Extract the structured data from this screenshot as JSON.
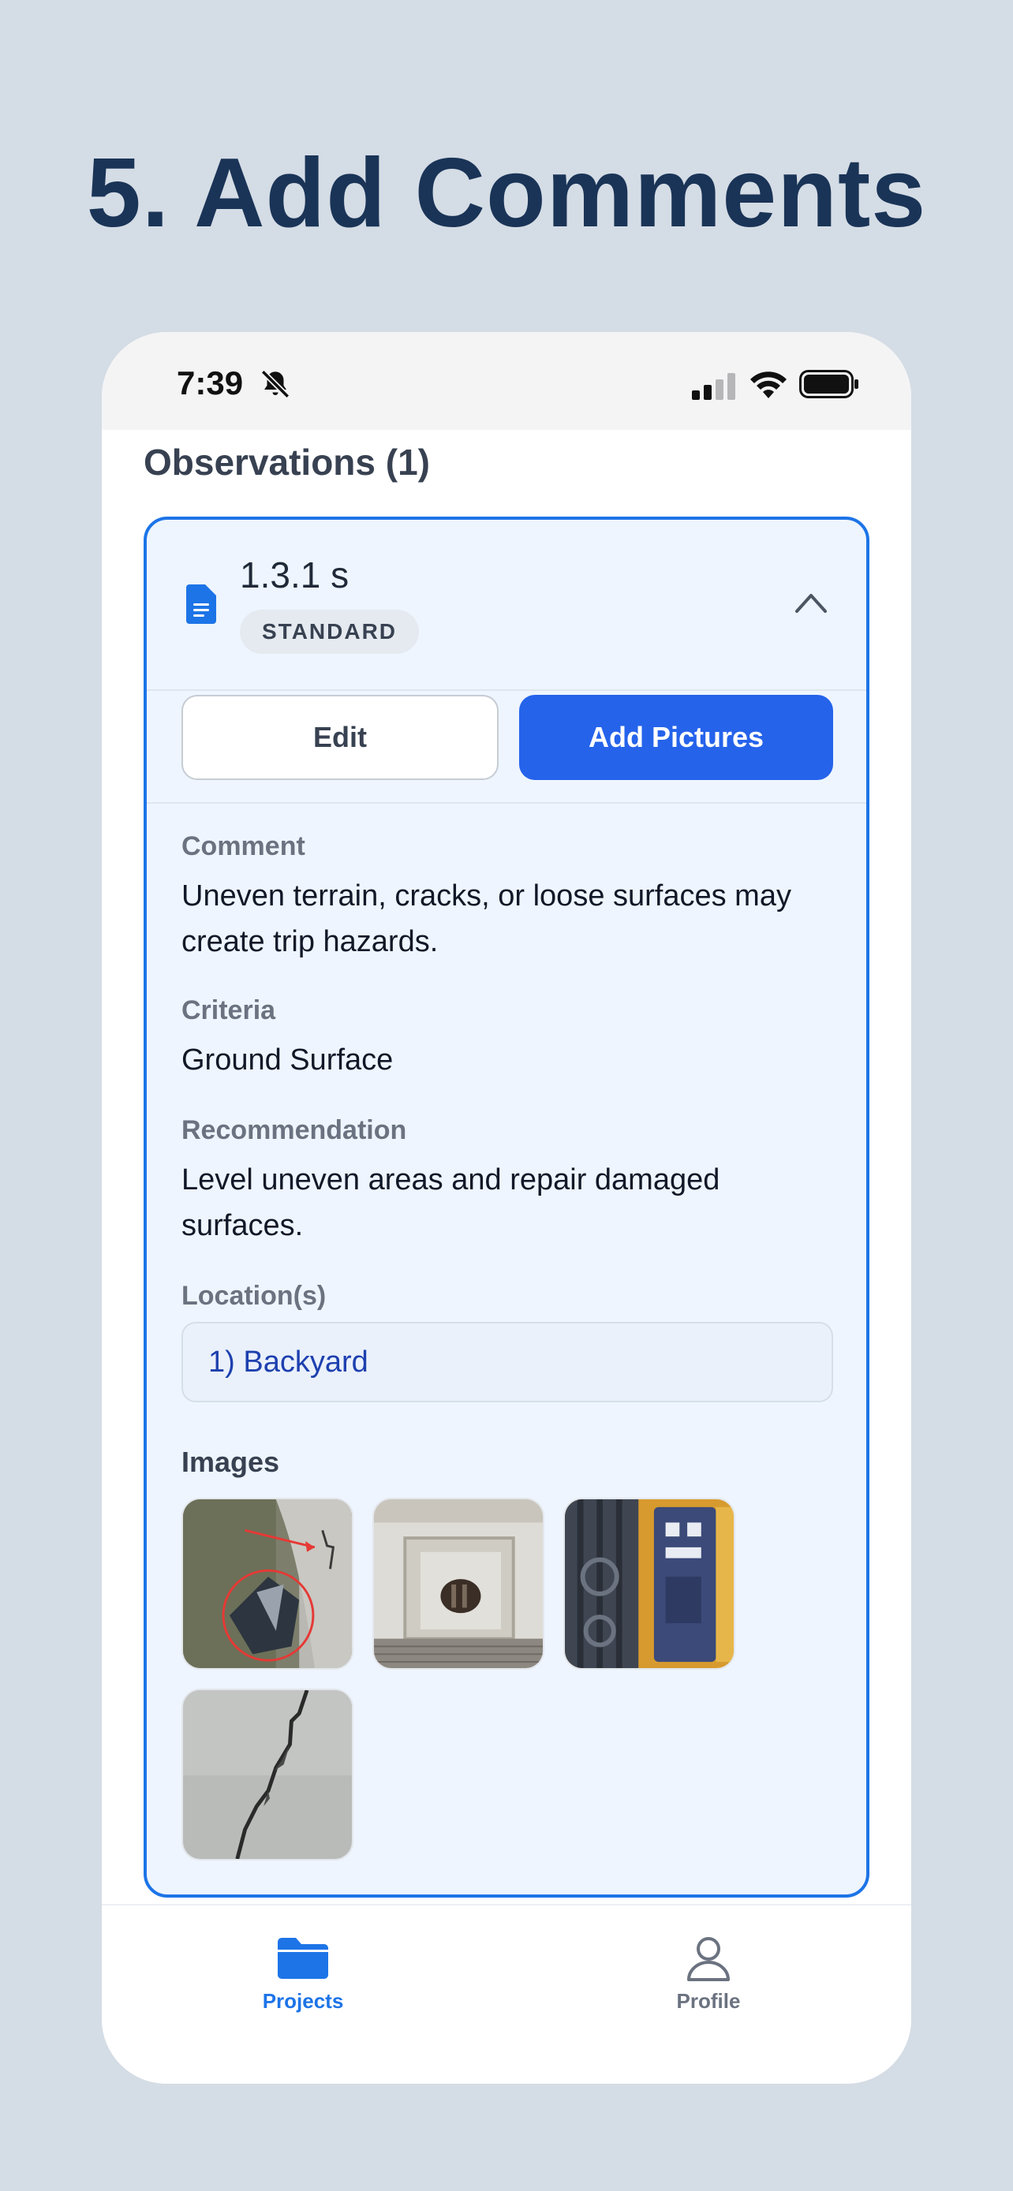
{
  "headline": "5. Add Comments",
  "status_bar": {
    "time": "7:39"
  },
  "section": {
    "title": "Observations (1)"
  },
  "observation": {
    "code": "1.3.1 s",
    "badge": "STANDARD",
    "edit_label": "Edit",
    "add_pictures_label": "Add Pictures",
    "comment_label": "Comment",
    "comment": "Uneven terrain, cracks, or loose surfaces may create trip hazards.",
    "criteria_label": "Criteria",
    "criteria": "Ground Surface",
    "recommendation_label": "Recommendation",
    "recommendation": "Level uneven areas and repair damaged surfaces.",
    "locations_label": "Location(s)",
    "locations": [
      "1) Backyard"
    ],
    "images_label": "Images",
    "images": [
      "damaged-wall-with-red-markup",
      "weathered-white-wall-opening",
      "rusty-blue-electrical-panel",
      "cracked-concrete-wall"
    ]
  },
  "tab_bar": {
    "tabs": [
      {
        "label": "Projects",
        "icon": "folder-icon",
        "active": true
      },
      {
        "label": "Profile",
        "icon": "person-icon",
        "active": false
      }
    ]
  },
  "colors": {
    "background": "#d4dce5",
    "headline": "#1a3457",
    "accent": "#2563eb",
    "card_border": "#1d74e7",
    "card_bg": "#eef5fe",
    "tab_active": "#1d74e7",
    "tab_inactive": "#6b7280"
  }
}
